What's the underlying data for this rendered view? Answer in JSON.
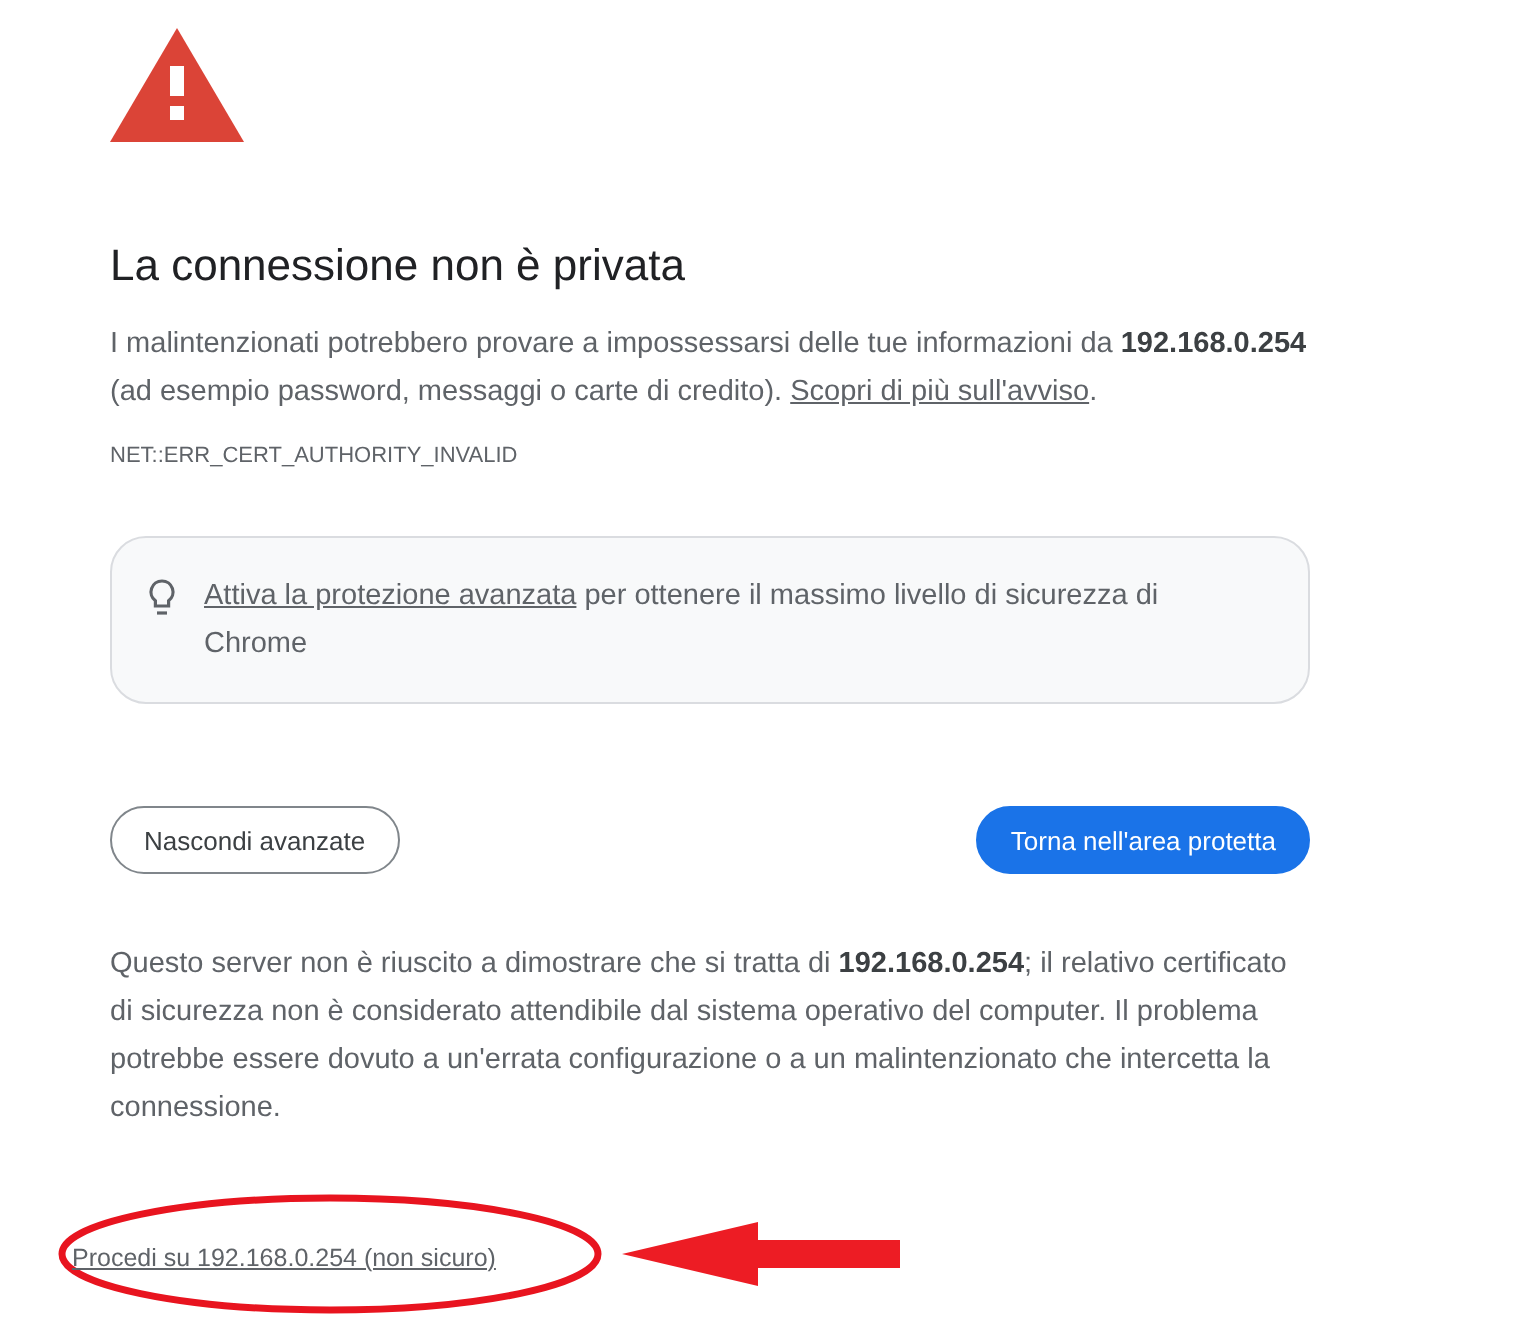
{
  "title": "La connessione non è privata",
  "intro": {
    "text": "I malintenzionati potrebbero provare a impossessarsi delle tue informazioni da **192.168.0.254** (ad esempio password, messaggi o carte di credito). ",
    "link": "Scopri di più sull'avviso",
    "after": "."
  },
  "error_code": "NET::ERR_CERT_AUTHORITY_INVALID",
  "enhanced_protection": {
    "link": "Attiva la protezione avanzata",
    "text": " per ottenere il massimo livello di sicurezza di Chrome"
  },
  "buttons": [
    {
      "label": "Nascondi avanzate",
      "kind": "secondary"
    },
    {
      "label": "Torna nell'area protetta",
      "kind": "primary"
    }
  ],
  "details": "Questo server non è riuscito a dimostrare che si tratta di **192.168.0.254**; il relativo certificato di sicurezza non è considerato attendibile dal sistema operativo del computer. Il problema potrebbe essere dovuto a un'errata configurazione o a un malintenzionato che intercetta la connessione.",
  "proceed_link": "Procedi su 192.168.0.254 (non sicuro)"
}
